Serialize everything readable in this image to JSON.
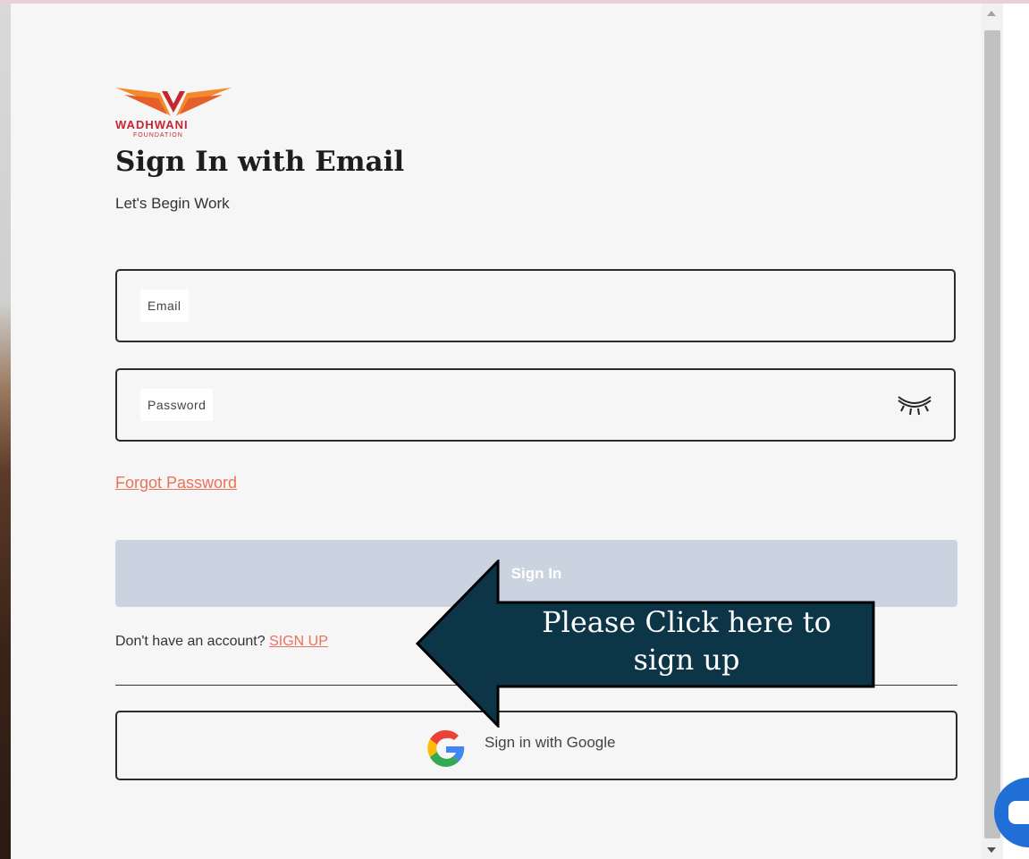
{
  "logo": {
    "name": "WADHWANI",
    "sub": "FOUNDATION"
  },
  "heading": {
    "title": "Sign In with Email",
    "subtitle": "Let's Begin Work"
  },
  "form": {
    "email_label": "Email",
    "password_label": "Password",
    "forgot_label": "Forgot Password",
    "signin_label": "Sign In",
    "no_account_text": "Don't have an account?",
    "signup_label": "SIGN UP",
    "google_label": "Sign in with Google"
  },
  "callout": {
    "line1": "Please Click here to",
    "line2": "sign up"
  },
  "colors": {
    "accent": "#e9735b",
    "button_disabled": "#cad3df",
    "callout_bg": "#0c3547",
    "chat": "#1f6fd6"
  }
}
